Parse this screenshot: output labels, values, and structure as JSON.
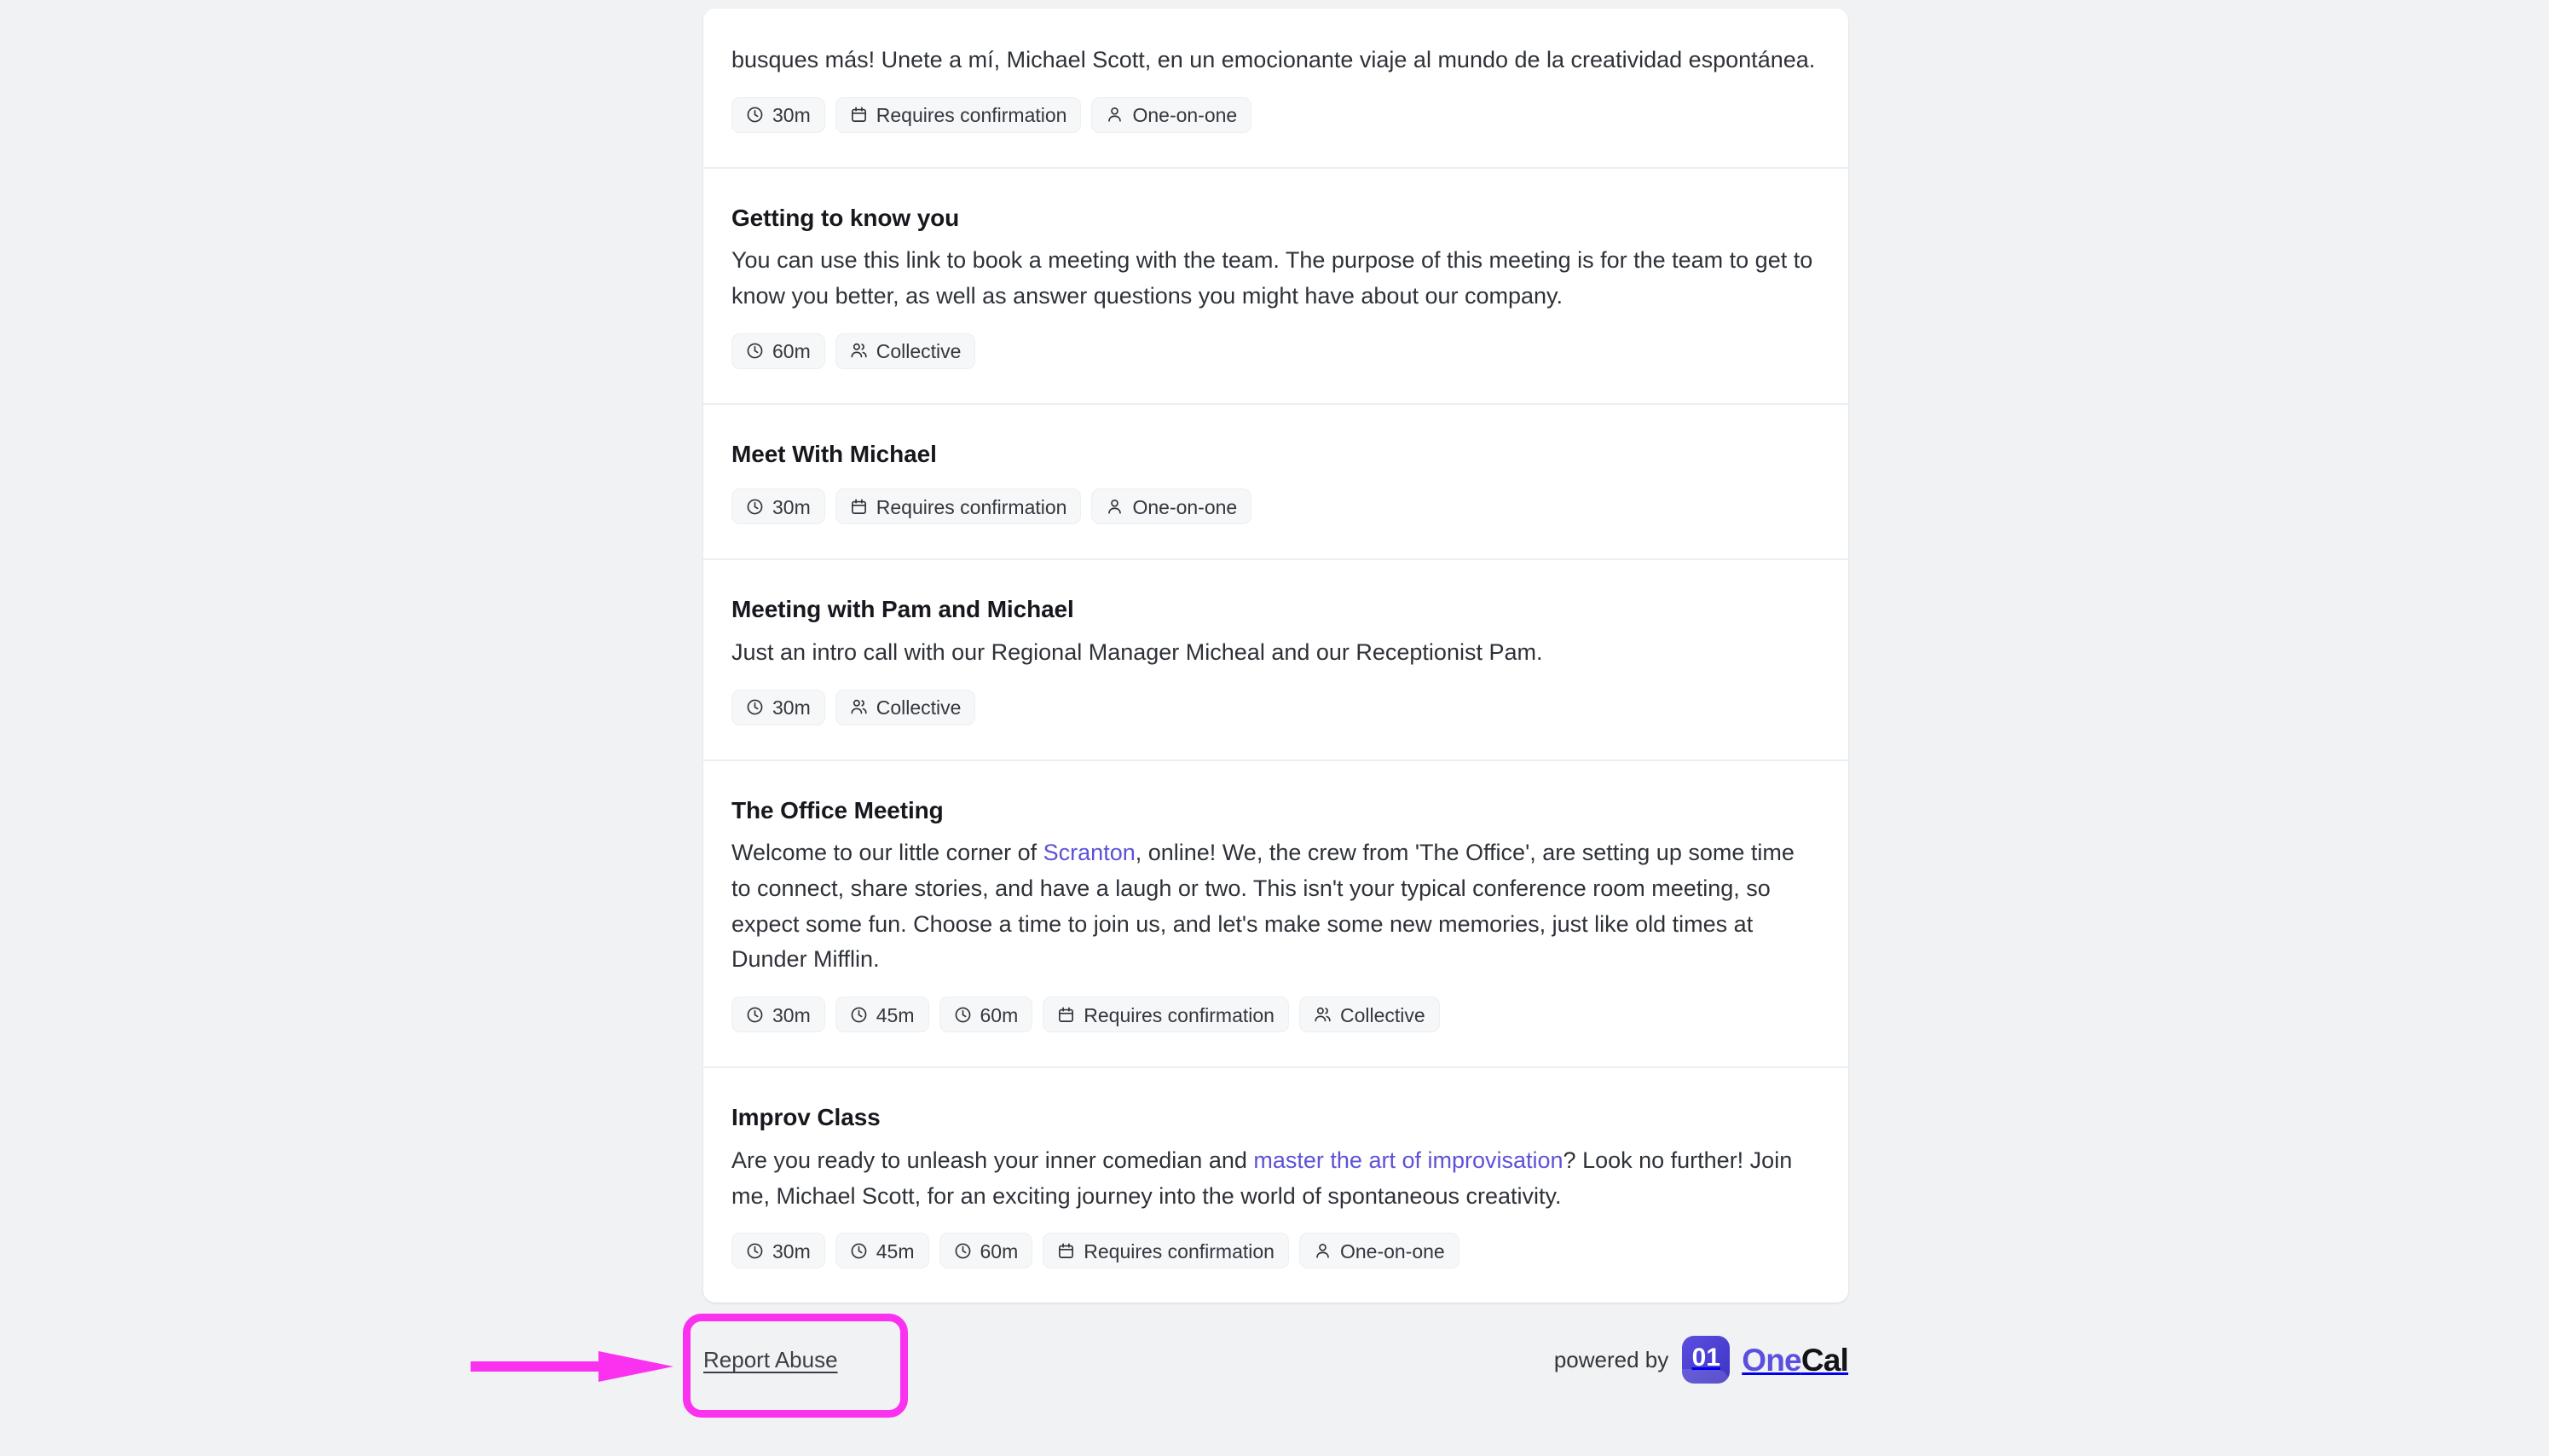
{
  "page": {
    "background_color": "#f1f2f4",
    "card_background": "#ffffff",
    "link_color": "#5d52d8",
    "annotation_color": "#fa32f0"
  },
  "events": [
    {
      "title": "",
      "description_html": "busques más! Unete a mí, Michael Scott, en un emocionante viaje al mundo de la creatividad espontánea.",
      "badges": [
        {
          "icon": "clock-icon",
          "label": "30m"
        },
        {
          "icon": "calendar-icon",
          "label": "Requires confirmation"
        },
        {
          "icon": "person-icon",
          "label": "One-on-one"
        }
      ]
    },
    {
      "title": "Getting to know you",
      "description_html": "You can use this link to book a meeting with the team. The purpose of this meeting is for the team to get to know you better, as well as answer questions you might have about our company.",
      "badges": [
        {
          "icon": "clock-icon",
          "label": "60m"
        },
        {
          "icon": "people-icon",
          "label": "Collective"
        }
      ]
    },
    {
      "title": "Meet With Michael",
      "description_html": "",
      "badges": [
        {
          "icon": "clock-icon",
          "label": "30m"
        },
        {
          "icon": "calendar-icon",
          "label": "Requires confirmation"
        },
        {
          "icon": "person-icon",
          "label": "One-on-one"
        }
      ]
    },
    {
      "title": "Meeting with Pam and Michael",
      "description_html": "Just an intro call with our Regional Manager Micheal and our Receptionist Pam.",
      "badges": [
        {
          "icon": "clock-icon",
          "label": "30m"
        },
        {
          "icon": "people-icon",
          "label": "Collective"
        }
      ]
    },
    {
      "title": "The Office Meeting",
      "description_html": "Welcome to our little corner of <a href=\"#\" data-name=\"inline-link-scranton\" data-interactable=\"true\">Scranton</a>, online! We, the crew from 'The Office', are setting up some time to connect, share stories, and have a laugh or two. This isn't your typical conference room meeting, so expect some fun. Choose a time to join us, and let's make some new memories, just like old times at Dunder Mifflin.",
      "badges": [
        {
          "icon": "clock-icon",
          "label": "30m"
        },
        {
          "icon": "clock-icon",
          "label": "45m"
        },
        {
          "icon": "clock-icon",
          "label": "60m"
        },
        {
          "icon": "calendar-icon",
          "label": "Requires confirmation"
        },
        {
          "icon": "people-icon",
          "label": "Collective"
        }
      ]
    },
    {
      "title": "Improv Class",
      "description_html": "Are you ready to unleash your inner comedian and <a href=\"#\" data-name=\"inline-link-master-the-art-of-improvisation\" data-interactable=\"true\">master the art of improvisation</a>? Look no further! Join me, Michael Scott, for an exciting journey into the world of spontaneous creativity.",
      "badges": [
        {
          "icon": "clock-icon",
          "label": "30m"
        },
        {
          "icon": "clock-icon",
          "label": "45m"
        },
        {
          "icon": "clock-icon",
          "label": "60m"
        },
        {
          "icon": "calendar-icon",
          "label": "Requires confirmation"
        },
        {
          "icon": "person-icon",
          "label": "One-on-one"
        }
      ]
    }
  ],
  "footer": {
    "report_abuse_label": "Report Abuse",
    "powered_by_label": "powered by",
    "brand": {
      "mark_digits": "01",
      "name_first": "One",
      "name_second": "Cal"
    }
  }
}
